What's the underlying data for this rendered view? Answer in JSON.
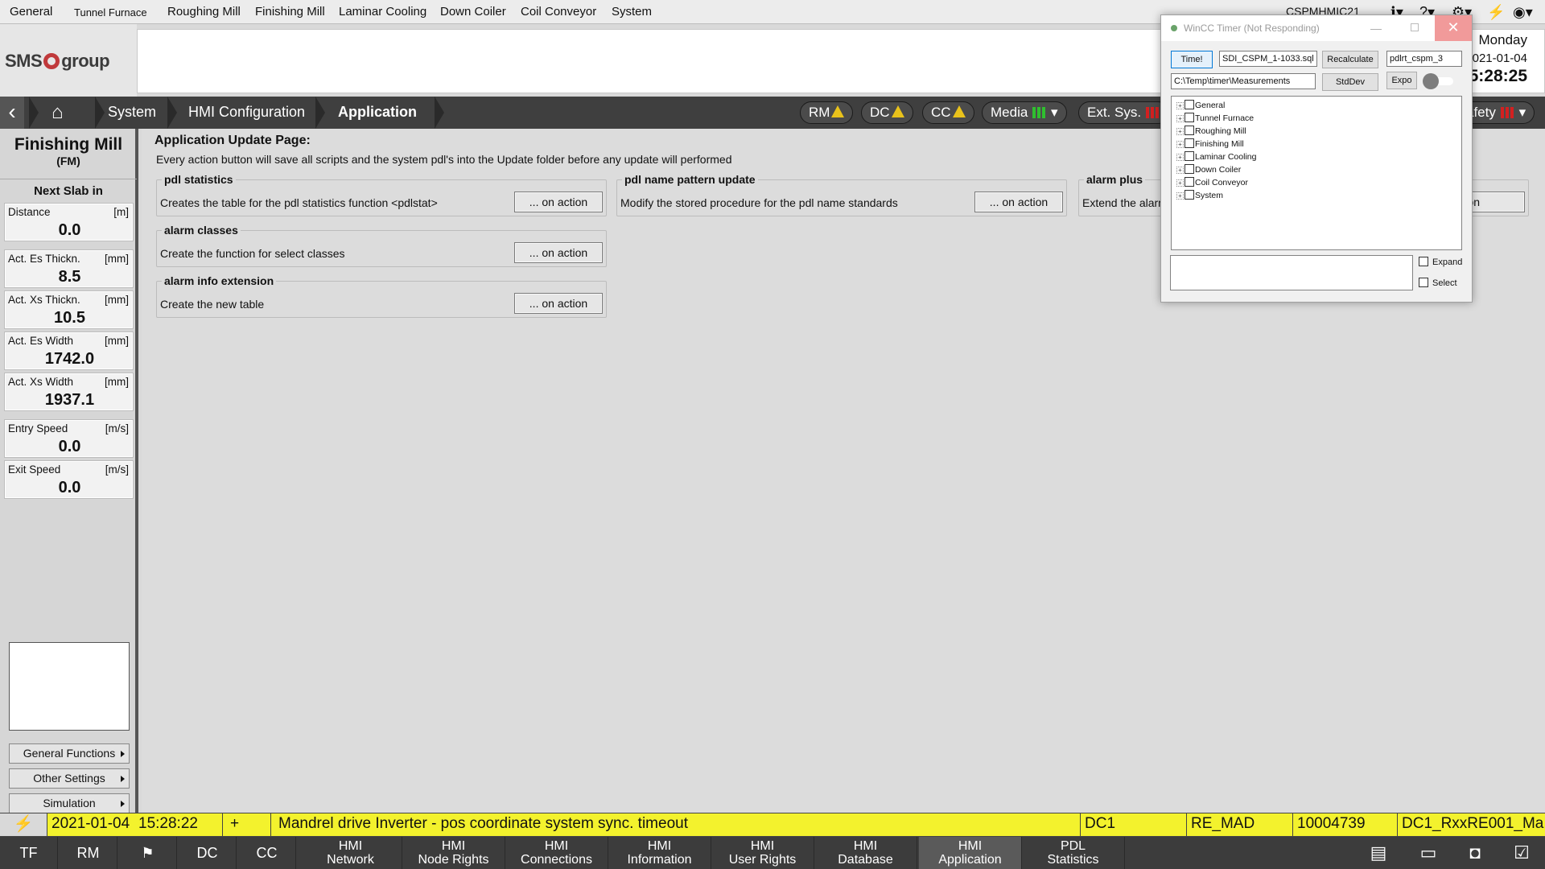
{
  "topbar": {
    "menu": [
      "General",
      "Tunnel Furnace",
      "Roughing Mill",
      "Finishing Mill",
      "Laminar Cooling",
      "Down Coiler",
      "Coil Conveyor",
      "System"
    ],
    "hostname": "CSPMHMIC21",
    "icons": [
      "info-icon",
      "help-icon",
      "gear-icon",
      "power-icon",
      "eye-icon"
    ]
  },
  "header": {
    "logo": {
      "left": "SMS",
      "right": "group"
    },
    "day": "Monday",
    "date": "2021-01-04",
    "time": "5:28:25",
    "date_visible": "021-01-04"
  },
  "nav": {
    "breadcrumbs": [
      "System",
      "HMI Configuration",
      "Application"
    ],
    "status": [
      {
        "label": "RM",
        "indicator": "warning"
      },
      {
        "label": "DC",
        "indicator": "warning"
      },
      {
        "label": "CC",
        "indicator": "warning"
      },
      {
        "label": "Media",
        "indicator": "green-bars"
      },
      {
        "label": "Ext. Sys.",
        "indicator": "red-bars"
      },
      {
        "label": "afety",
        "indicator": "red-bars"
      }
    ],
    "colors": {
      "warning": "#e9c21b",
      "ok": "#2fbf2f",
      "error": "#d32020"
    }
  },
  "left_panel": {
    "title": "Finishing Mill",
    "subtitle": "(FM)",
    "next_slab": "Next Slab in",
    "metrics": [
      {
        "label": "Distance",
        "unit": "[m]",
        "value": "0.0"
      },
      {
        "label": "Act. Es Thickn.",
        "unit": "[mm]",
        "value": "8.5"
      },
      {
        "label": "Act. Xs Thickn.",
        "unit": "[mm]",
        "value": "10.5"
      },
      {
        "label": "Act. Es Width",
        "unit": "[mm]",
        "value": "1742.0"
      },
      {
        "label": "Act. Xs Width",
        "unit": "[mm]",
        "value": "1937.1"
      },
      {
        "label": "Entry Speed",
        "unit": "[m/s]",
        "value": "0.0"
      },
      {
        "label": "Exit Speed",
        "unit": "[m/s]",
        "value": "0.0"
      }
    ],
    "buttons": [
      "General Functions",
      "Other Settings",
      "Simulation"
    ]
  },
  "main": {
    "title": "Application Update Page:",
    "description": "Every action button will save all scripts and the system pdl's into the Update folder before any update will performed",
    "groups": [
      {
        "title": "pdl statistics",
        "desc": "Creates the table for the pdl statistics function <pdlstat>",
        "button": "... on action"
      },
      {
        "title": "pdl name pattern update",
        "desc": "Modify the stored procedure for the pdl name standards",
        "button": "... on action"
      },
      {
        "title": "alarm plus",
        "desc": "Extend the alarm",
        "button": "n action"
      },
      {
        "title": "alarm classes",
        "desc": "Create the function for select classes",
        "button": "... on action"
      },
      {
        "title": "alarm info extension",
        "desc": "Create the new table",
        "button": "... on action"
      }
    ]
  },
  "timer_window": {
    "title": "WinCC Timer (Not Responding)",
    "close": "✕",
    "time_button": "Time!",
    "sql_field": "SDI_CSPM_1-1033.sql",
    "recalculate": "Recalculate",
    "pdlrt_field": "pdlrt_cspm_3",
    "path_field": "C:\\Temp\\timer\\Measurements",
    "stddev": "StdDev",
    "expo": "Expo",
    "tree": [
      "General",
      "Tunnel Furnace",
      "Roughing Mill",
      "Finishing Mill",
      "Laminar Cooling",
      "Down Coiler",
      "Coil Conveyor",
      "System"
    ],
    "expand_label": "Expand",
    "select_label": "Select"
  },
  "alarm_line": {
    "date": "2021-01-04",
    "time": "15:28:22",
    "sign": "+",
    "message": "Mandrel drive Inverter - pos coordinate system sync. timeout",
    "area": "DC1",
    "unit": "RE_MAD",
    "number": "10004739",
    "tag": "DC1_RxxRE001_Ma",
    "color": "#f3f22d"
  },
  "bottom_bar": {
    "area_buttons": [
      "TF",
      "RM",
      "DC",
      "CC"
    ],
    "tabs": [
      {
        "line1": "HMI",
        "line2": "Network"
      },
      {
        "line1": "HMI",
        "line2": "Node Rights"
      },
      {
        "line1": "HMI",
        "line2": "Connections"
      },
      {
        "line1": "HMI",
        "line2": "Information"
      },
      {
        "line1": "HMI",
        "line2": "User Rights"
      },
      {
        "line1": "HMI",
        "line2": "Database"
      },
      {
        "line1": "HMI",
        "line2": "Application"
      },
      {
        "line1": "PDL",
        "line2": "Statistics"
      }
    ],
    "active_tab": "Application"
  }
}
